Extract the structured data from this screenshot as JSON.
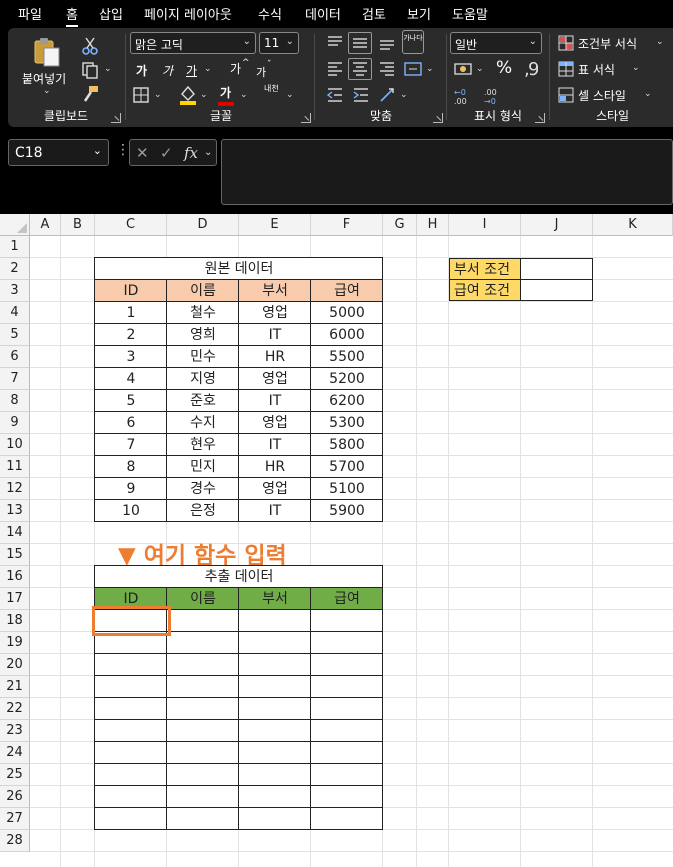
{
  "menu": {
    "tabs": [
      "파일",
      "홈",
      "삽입",
      "페이지 레이아웃",
      "수식",
      "데이터",
      "검토",
      "보기",
      "도움말"
    ],
    "active": "홈"
  },
  "ribbon": {
    "clipboard": {
      "paste_label": "붙여넣기",
      "group_label": "클립보드"
    },
    "font": {
      "font_name": "맑은 고딕",
      "font_size": "11",
      "bold": "가",
      "italic": "가",
      "underline": "가",
      "grow": "가",
      "shrink": "가",
      "font_color_glyph": "가",
      "phonetic": "내천",
      "group_label": "글꼴",
      "fill_color": "#ffd700",
      "font_color": "#e00000"
    },
    "alignment": {
      "wrap_glyph": "가나다",
      "group_label": "맞춤"
    },
    "number": {
      "format": "일반",
      "percent": "%",
      "group_label": "표시 형식"
    },
    "styles": {
      "conditional": "조건부 서식",
      "table_format": "표 서식",
      "cell_styles": "셀 스타일",
      "group_label": "스타일"
    }
  },
  "formula_bar": {
    "name_box": "C18",
    "fx": "fx",
    "formula": ""
  },
  "sheet": {
    "columns": [
      "A",
      "B",
      "C",
      "D",
      "E",
      "F",
      "G",
      "H",
      "I",
      "J",
      "K"
    ],
    "rows": [
      "1",
      "2",
      "3",
      "4",
      "5",
      "6",
      "7",
      "8",
      "9",
      "10",
      "11",
      "12",
      "13",
      "14",
      "15",
      "16",
      "17",
      "18",
      "19",
      "20",
      "21",
      "22",
      "23",
      "24",
      "25",
      "26",
      "27",
      "28"
    ],
    "source_table": {
      "title": "원본 데이터",
      "headers": [
        "ID",
        "이름",
        "부서",
        "급여"
      ],
      "rows": [
        [
          "1",
          "철수",
          "영업",
          "5000"
        ],
        [
          "2",
          "영희",
          "IT",
          "6000"
        ],
        [
          "3",
          "민수",
          "HR",
          "5500"
        ],
        [
          "4",
          "지영",
          "영업",
          "5200"
        ],
        [
          "5",
          "준호",
          "IT",
          "6200"
        ],
        [
          "6",
          "수지",
          "영업",
          "5300"
        ],
        [
          "7",
          "현우",
          "IT",
          "5800"
        ],
        [
          "8",
          "민지",
          "HR",
          "5700"
        ],
        [
          "9",
          "경수",
          "영업",
          "5100"
        ],
        [
          "10",
          "은정",
          "IT",
          "5900"
        ]
      ]
    },
    "conditions": {
      "dept_label": "부서 조건",
      "dept_value": "",
      "salary_label": "급여 조건",
      "salary_value": ""
    },
    "callout": "▼ 여기 함수 입력",
    "extract_table": {
      "title": "추출 데이터",
      "headers": [
        "ID",
        "이름",
        "부서",
        "급여"
      ]
    },
    "colors": {
      "source_header": "#f8cbad",
      "extract_header": "#70ad47",
      "condition_label": "#ffd966",
      "highlight": "#ed7d31"
    }
  }
}
